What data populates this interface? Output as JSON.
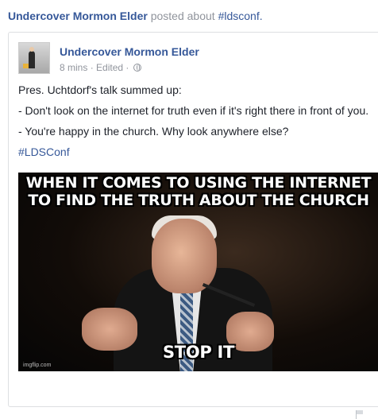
{
  "share_header": {
    "author": "Undercover Mormon Elder",
    "action": "posted about",
    "hashtag": "#ldsconf."
  },
  "post": {
    "author": "Undercover Mormon Elder",
    "time": "8 mins",
    "separator": "·",
    "edited": "Edited",
    "separator2": "·",
    "privacy_icon": "globe-icon",
    "lines": [
      "Pres. Uchtdorf's talk summed up:",
      "- Don't look on the internet for truth even if it's right there in front of you.",
      "- You're happy in the church. Why look anywhere else?"
    ],
    "hashtag": "#LDSConf"
  },
  "meme": {
    "top_text_line1": "WHEN IT COMES TO USING THE INTERNET",
    "top_text_line2": "TO FIND THE TRUTH ABOUT THE CHURCH",
    "bottom_text": "STOP IT",
    "watermark": "imgflip.com"
  },
  "colors": {
    "link": "#365899",
    "meta": "#90949c",
    "text": "#1d2129"
  }
}
